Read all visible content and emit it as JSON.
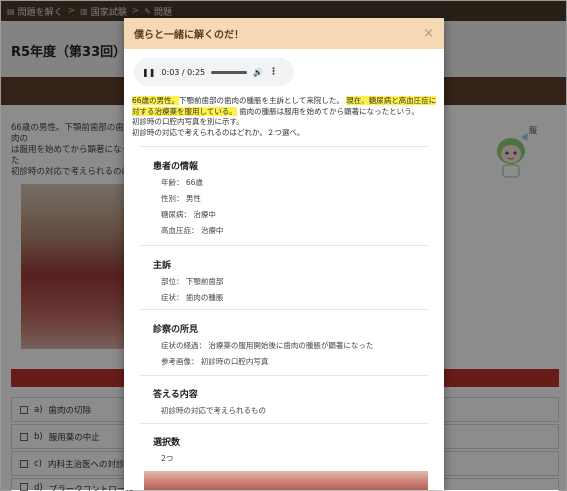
{
  "breadcrumb": {
    "home": "問題を解く",
    "exam": "国家試験",
    "current": "問題"
  },
  "page": {
    "title": "R5年度（第33回）　歯",
    "question_lines": [
      "66歳の男性。下顎前歯部の歯肉の",
      "は服用を始めてから顕著になった",
      "初診時の対応で考えられるのは"
    ],
    "question_fragment_right": "服"
  },
  "choices": [
    {
      "label": "a)",
      "text": "歯肉の切除"
    },
    {
      "label": "b)",
      "text": "服用薬の中止"
    },
    {
      "label": "c)",
      "text": "内科主治医への対診"
    },
    {
      "label": "d)",
      "text": "プラークコントロール"
    }
  ],
  "modal": {
    "title": "僕らと一緒に解くのだ！",
    "close": "×",
    "audio": {
      "time": "0:03 / 0:25",
      "progress": 0.12
    },
    "passage": {
      "hl1": "66歳の男性。",
      "t1": "下顎前歯部の歯肉の腫脹を主訴として来院した。",
      "hl2": "現在、糖尿病と高血圧症に対する治療薬を服用している。",
      "t2": "歯肉の腫脹は服用を始めてから顕著になったという。",
      "t3": "初診時の口腔内写真を別に示す。",
      "t4": "初診時の対応で考えられるのはどれか。２つ選べ。"
    },
    "sections": {
      "patient": {
        "heading": "患者の情報",
        "age": "年齢： 66歳",
        "sex": "性別： 男性",
        "diabetes": "糖尿病： 治療中",
        "hypertension": "高血圧症： 治療中"
      },
      "complaint": {
        "heading": "主訴",
        "site": "部位： 下顎前歯部",
        "symptom": "症状： 歯肉の腫脹"
      },
      "findings": {
        "heading": "診察の所見",
        "course": "症状の経過： 治療薬の服用開始後に歯肉の腫脹が顕著になった",
        "reference": "参考画像： 初診時の口腔内写真"
      },
      "answer": {
        "heading": "答える内容",
        "content": "初診時の対応で考えられるもの"
      },
      "count": {
        "heading": "選択数",
        "value": "2つ"
      }
    }
  }
}
